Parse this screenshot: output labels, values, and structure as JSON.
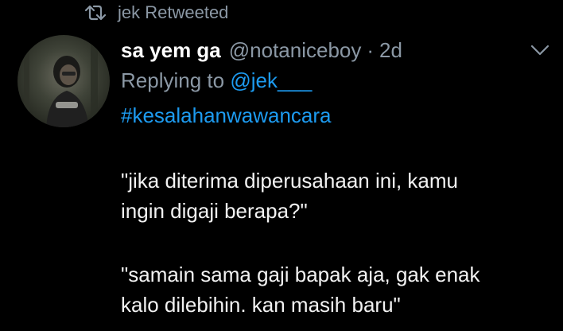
{
  "retweet": {
    "icon": "retweet-icon",
    "label": "jek Retweeted"
  },
  "tweet": {
    "display_name": "sa yem ga",
    "handle": "@notaniceboy",
    "separator": "·",
    "time": "2d",
    "replying_prefix": "Replying to",
    "replying_handle": "@jek___",
    "hashtag": "#kesalahanwawancara",
    "paragraph1_line1": "\"jika diterima diperusahaan ini, kamu",
    "paragraph1_line2": "ingin digaji berapa?\"",
    "paragraph2_line1": "\"samain sama gaji bapak aja, gak enak",
    "paragraph2_line2": "kalo dilebihin. kan masih baru\""
  },
  "icons": {
    "avatar": "avatar",
    "menu": "chevron-down-icon"
  },
  "colors": {
    "background": "#000000",
    "text": "#e7e9ea",
    "secondary": "#8b98a5",
    "link": "#1d9bf0"
  }
}
